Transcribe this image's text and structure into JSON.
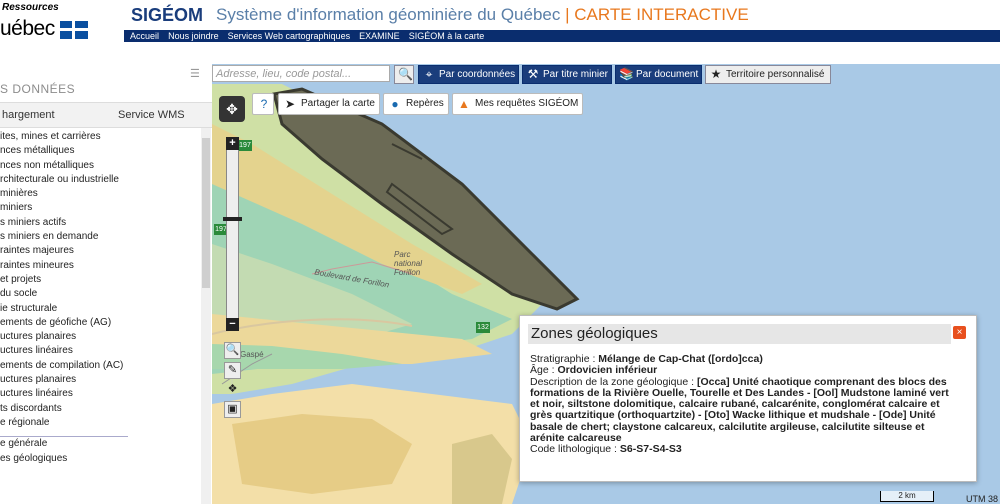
{
  "header": {
    "logo_top": "Ressources",
    "logo_name": "uébec",
    "brand": "SIGÉOM",
    "title": "Système d'information géominière du Québec",
    "separator": "|",
    "title_accent": "CARTE INTERACTIVE",
    "nav": [
      "Accueil",
      "Nous joindre",
      "Services Web cartographiques",
      "EXAMINE",
      "SIGÉOM à la carte"
    ]
  },
  "sidebar": {
    "heading": "S DONNÉES",
    "tabs": [
      "hargement",
      "Service WMS"
    ],
    "items": [
      "ites, mines et carrières",
      "nces métalliques",
      "nces non métalliques",
      "rchitecturale ou industrielle",
      "minières",
      "miniers",
      "s miniers actifs",
      "s miniers en demande",
      "raintes majeures",
      "raintes mineures",
      "et projets",
      "du socle",
      "ie structurale",
      "ements de géofiche (AG)",
      "uctures planaires",
      "uctures linéaires",
      "ements de compilation (AC)",
      "uctures planaires",
      "uctures linéaires",
      "ts discordants",
      "e régionale",
      "e générale",
      "es géologiques"
    ]
  },
  "toolbar": {
    "search_placeholder": "Adresse, lieu, code postal...",
    "btn_coords": "Par coordonnées",
    "btn_title": "Par titre minier",
    "btn_doc": "Par document",
    "btn_territory": "Territoire personnalisé"
  },
  "maptools": {
    "share": "Partager la carte",
    "markers": "Repères",
    "requests": "Mes requêtes SIGÉOM"
  },
  "map_labels": {
    "road": "Boulevard de Forillon",
    "park": "Parc national Forillon",
    "place": "Gaspé",
    "route1": "197",
    "route2": "197",
    "route3": "132"
  },
  "popup": {
    "title": "Zones géologiques",
    "close": "×",
    "strat_label": "Stratigraphie : ",
    "strat_value": "Mélange de Cap-Chat ([ordo]cca)",
    "age_label": "Âge : ",
    "age_value": "Ordovicien inférieur",
    "desc_label": "Description de la zone géologique : ",
    "desc_value": "[Occa] Unité chaotique comprenant des blocs des formations de la Rivière Ouelle, Tourelle et Des Landes - [Ool] Mudstone laminé vert et noir, siltstone dolomitique, calcaire rubané, calcarénite, conglomérat calcaire et grès quartzitique (orthoquartzite) - [Oto] Wacke lithique et mudshale - [Ode] Unité basale de chert; claystone calcareux, calcilutite argileuse, calcilutite silteuse et arénite calcareuse",
    "code_label": "Code lithologique : ",
    "code_value": "S6-S7-S4-S3"
  },
  "scale": "2 km",
  "utm": "UTM 38"
}
